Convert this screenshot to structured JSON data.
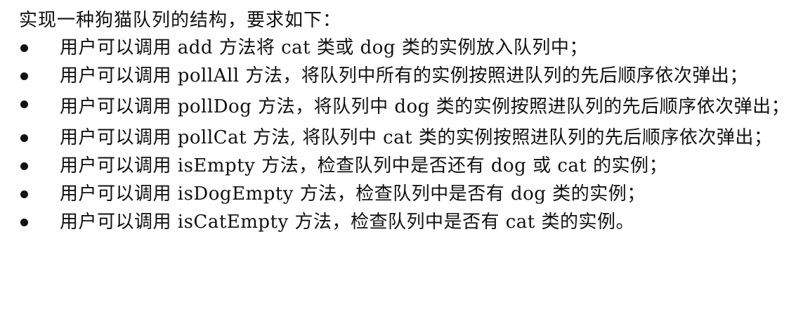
{
  "intro": "实现一种狗猫队列的结构，要求如下：",
  "items": [
    {
      "text": "用户可以调用 add 方法将 cat 类或 dog 类的实例放入队列中；"
    },
    {
      "text": "用户可以调用 pollAll 方法，将队列中所有的实例按照进队列的先后顺序依次弹出；"
    },
    {
      "text": "用户可以调用 pollDog 方法，将队列中 dog 类的实例按照进队列的先后顺序依次弹出；"
    },
    {
      "text": "用户可以调用 pollCat 方法, 将队列中 cat 类的实例按照进队列的先后顺序依次弹出；"
    },
    {
      "text": "用户可以调用 isEmpty 方法，检查队列中是否还有 dog 或 cat 的实例；"
    },
    {
      "text": "用户可以调用 isDogEmpty 方法，检查队列中是否有 dog 类的实例；"
    },
    {
      "text": "用户可以调用 isCatEmpty 方法，检查队列中是否有 cat 类的实例。"
    }
  ]
}
